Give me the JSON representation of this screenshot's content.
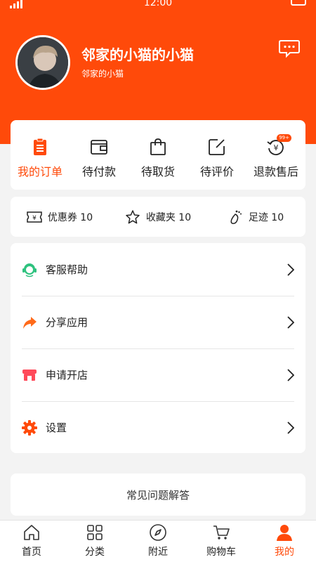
{
  "status": {
    "time": "12:00"
  },
  "profile": {
    "name": "邻家的小猫的小猫",
    "subtitle": "邻家的小猫"
  },
  "orders": [
    {
      "label": "我的订单",
      "icon": "clipboard-icon",
      "active": true
    },
    {
      "label": "待付款",
      "icon": "wallet-icon"
    },
    {
      "label": "待取货",
      "icon": "shopping-bag-icon"
    },
    {
      "label": "待评价",
      "icon": "edit-icon"
    },
    {
      "label": "退款售后",
      "icon": "refund-icon",
      "badge": "99+"
    }
  ],
  "stats": [
    {
      "label": "优惠券 10",
      "icon": "coupon-icon"
    },
    {
      "label": "收藏夹 10",
      "icon": "star-icon"
    },
    {
      "label": "足迹 10",
      "icon": "footprint-icon"
    }
  ],
  "menu": [
    {
      "label": "客服帮助",
      "icon": "headset-icon",
      "color": "#2ec27e"
    },
    {
      "label": "分享应用",
      "icon": "share-icon",
      "color": "#ff6a1a"
    },
    {
      "label": "申请开店",
      "icon": "store-icon",
      "color": "#ff4a5a"
    },
    {
      "label": "设置",
      "icon": "gear-icon",
      "color": "#ff4a0a"
    }
  ],
  "faq": "常见问题解答",
  "tabs": [
    {
      "label": "首页",
      "icon": "home-icon"
    },
    {
      "label": "分类",
      "icon": "grid-icon"
    },
    {
      "label": "附近",
      "icon": "compass-icon"
    },
    {
      "label": "购物车",
      "icon": "cart-icon"
    },
    {
      "label": "我的",
      "icon": "user-icon",
      "active": true
    }
  ],
  "colors": {
    "accent": "#ff4a0a",
    "background": "#f3f3f3"
  }
}
